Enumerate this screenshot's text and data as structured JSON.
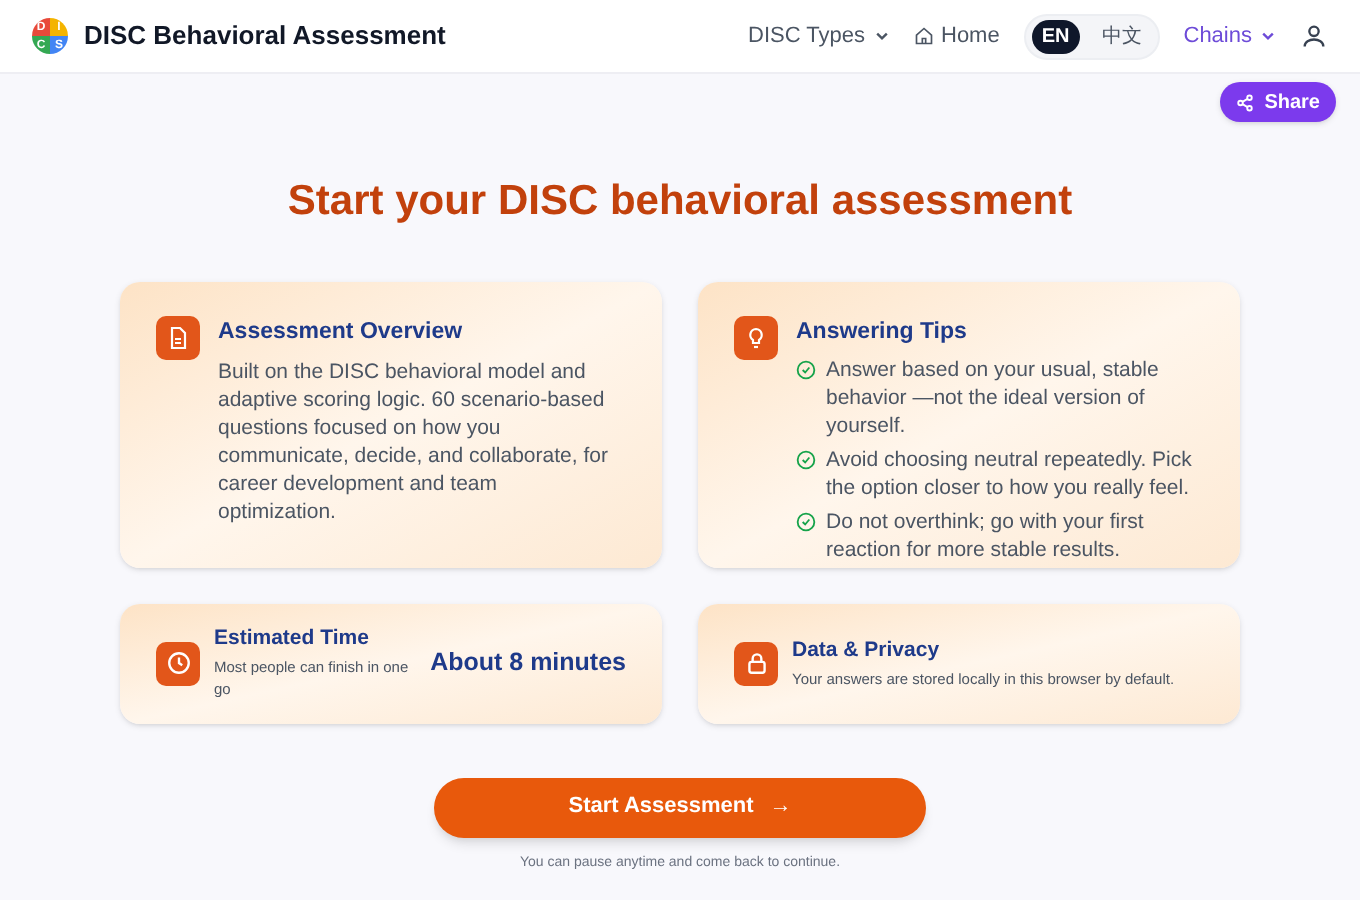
{
  "header": {
    "logo_letters": [
      "D",
      "I",
      "C",
      "S"
    ],
    "title": "DISC Behavioral Assessment",
    "nav": [
      {
        "kind": "dropdown",
        "label": "DISC Types"
      },
      {
        "kind": "home",
        "label": "Home"
      }
    ],
    "languages": [
      {
        "label": "EN",
        "selected": true
      },
      {
        "label": "中文",
        "selected": false
      }
    ],
    "chains": {
      "label": "Chains"
    }
  },
  "share_button": {
    "label": "Share"
  },
  "heading": "Start your DISC behavioral assessment",
  "cards": [
    {
      "kind": "document",
      "title": "Assessment Overview",
      "body": "Built on the DISC behavioral model and adaptive scoring logic. 60 scenario-based questions focused on how you communicate, decide, and collaborate, for career development and team optimization."
    },
    {
      "kind": "bulb",
      "title": "Answering Tips",
      "tips": [
        "Answer based on your usual, stable behavior —not the ideal version of yourself.",
        "Avoid choosing neutral repeatedly. Pick the option closer to how you really feel.",
        "Do not overthink; go with your first reaction for more stable results."
      ]
    }
  ],
  "info_cards": [
    {
      "kind": "clock",
      "title": "Estimated Time",
      "subtitle": "Most people can finish in one go",
      "value": "About 8 minutes"
    },
    {
      "kind": "lock",
      "title": "Data & Privacy",
      "subtitle": "Your answers are stored locally in this browser by default."
    }
  ],
  "start_button": {
    "label": "Start Assessment",
    "arrow": "→"
  },
  "footnote": "You can pause anytime and come back to continue."
}
